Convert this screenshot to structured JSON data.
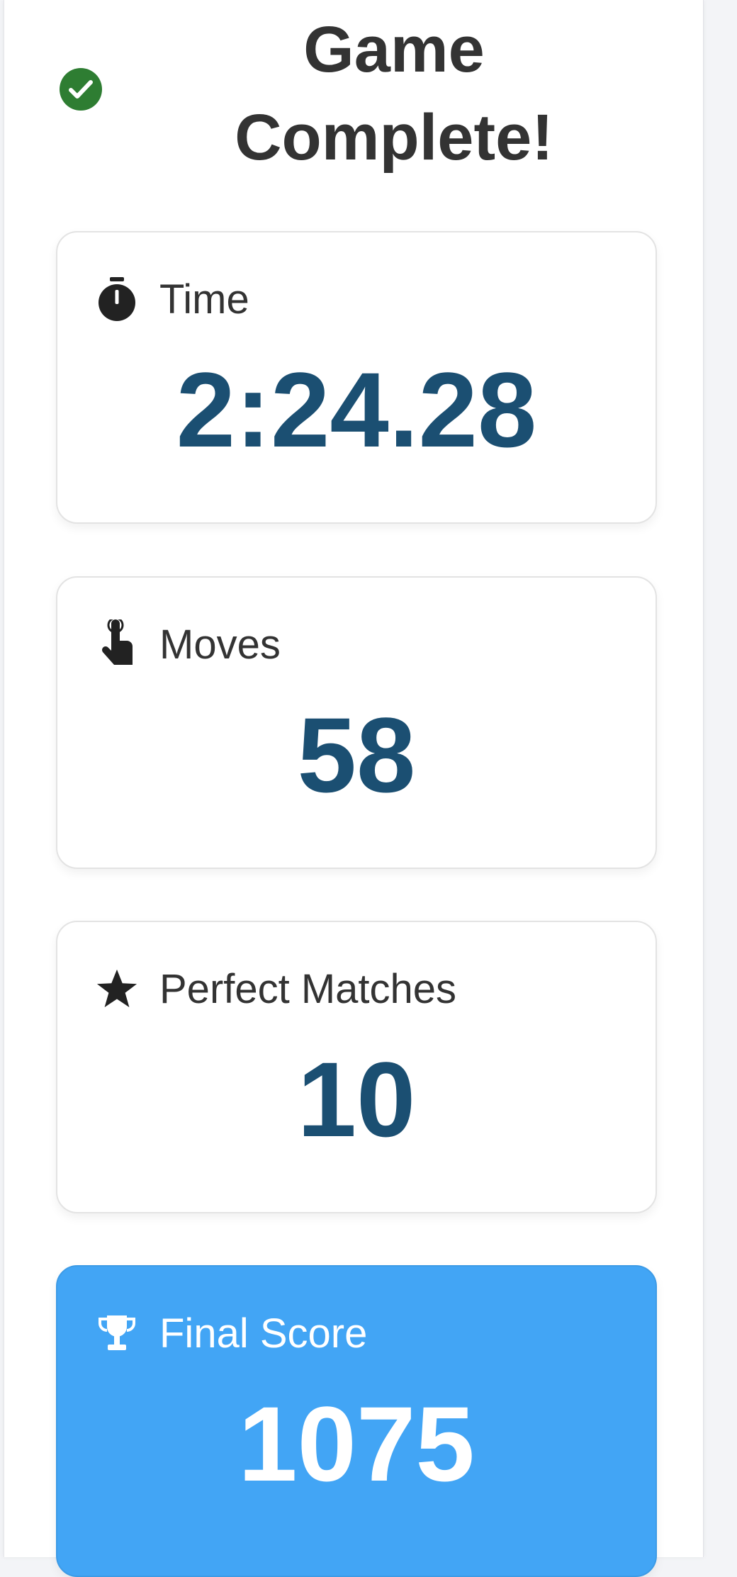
{
  "header": {
    "title": "Game Complete!",
    "check_icon": "check-circle-icon",
    "check_color": "#2e7d32"
  },
  "stats": {
    "time": {
      "label": "Time",
      "value": "2:24.28",
      "icon": "stopwatch-icon"
    },
    "moves": {
      "label": "Moves",
      "value": "58",
      "icon": "pointer-hand-icon"
    },
    "perfect_matches": {
      "label": "Perfect Matches",
      "value": "10",
      "icon": "star-icon"
    },
    "final_score": {
      "label": "Final Score",
      "value": "1075",
      "icon": "trophy-icon"
    }
  },
  "colors": {
    "value_text": "#1b4f72",
    "highlight_bg": "#42a5f5",
    "label_text": "#333333"
  }
}
